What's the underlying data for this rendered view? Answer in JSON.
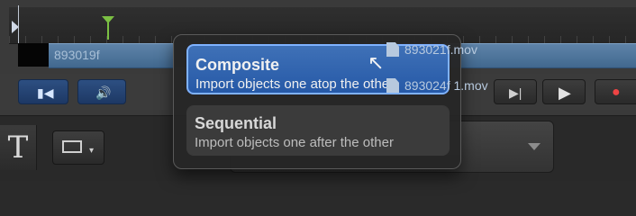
{
  "timeline": {
    "clip_label_left": "893019f"
  },
  "tools": {
    "text_tool": "T"
  },
  "popover": {
    "options": [
      {
        "title": "Composite",
        "subtitle": "Import objects one atop the other"
      },
      {
        "title": "Sequential",
        "subtitle": "Import objects one after the other"
      }
    ],
    "files": [
      "893021f.mov",
      "893024f 1.mov"
    ]
  }
}
